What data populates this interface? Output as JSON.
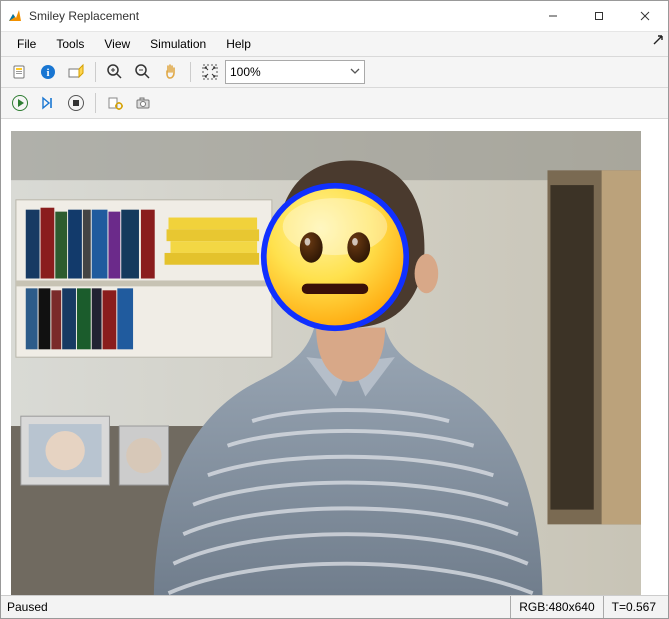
{
  "titlebar": {
    "title": "Smiley Replacement"
  },
  "menu": {
    "items": [
      "File",
      "Tools",
      "View",
      "Simulation",
      "Help"
    ]
  },
  "toolbar1": {
    "zoom_value": "100%"
  },
  "status": {
    "state": "Paused",
    "resolution": "RGB:480x640",
    "time": "T=0.567"
  },
  "icons": {
    "app": "matlab-icon",
    "minimize": "minimize-icon",
    "maximize": "maximize-icon",
    "close": "close-icon",
    "new_model": "new-model-icon",
    "info": "info-icon",
    "highlight": "highlight-icon",
    "zoom_in": "zoom-in-icon",
    "zoom_out": "zoom-out-icon",
    "pan": "pan-icon",
    "fit": "fit-view-icon",
    "play": "play-icon",
    "step": "step-forward-icon",
    "stop": "stop-icon",
    "settings": "settings-icon",
    "snapshot": "camera-icon"
  },
  "colors": {
    "smiley_ring": "#1030ff",
    "smiley_fill_top": "#ffe869",
    "smiley_fill_bot": "#ffaa00",
    "smiley_eye": "#3a1f0a",
    "smiley_mouth": "#3a1008"
  }
}
